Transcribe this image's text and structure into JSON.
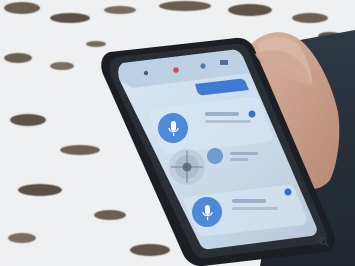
{
  "photo": {
    "subject": "hand holding rugged android phone over snowy ground",
    "colors": {
      "snow": "#eef0f2",
      "soil": "#4b3f33",
      "phone_body": "#1d2024",
      "screen_bg": "#cfe0ef",
      "accent_blue": "#2f6fd1",
      "skin": "#c9a08c",
      "sleeve": "#27313a"
    }
  },
  "phone_ui": {
    "icons": {
      "status": "status-bar-icons",
      "fab_primary": "mic-icon",
      "fab_secondary": "mic-icon",
      "dial": "dial-icon",
      "search": "search-icon"
    }
  }
}
